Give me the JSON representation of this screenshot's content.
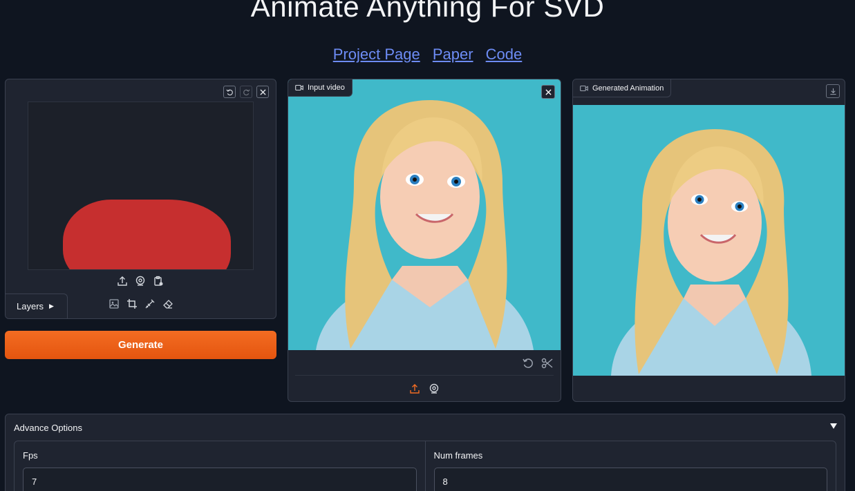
{
  "header": {
    "title": "Animate Anything For SVD",
    "links": [
      {
        "label": "Project Page"
      },
      {
        "label": "Paper"
      },
      {
        "label": "Code"
      }
    ]
  },
  "editor": {
    "layers_label": "Layers",
    "brush_color": "#c62f2f"
  },
  "generate": {
    "label": "Generate",
    "color": "#f36c22"
  },
  "input_video": {
    "label": "Input video"
  },
  "output": {
    "label": "Generated Animation"
  },
  "advance": {
    "title": "Advance Options",
    "fps": {
      "label": "Fps",
      "value": "7"
    },
    "num_frames": {
      "label": "Num frames",
      "value": "8"
    }
  }
}
